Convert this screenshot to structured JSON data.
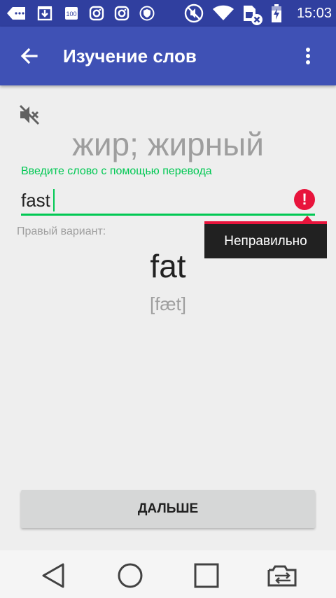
{
  "status_bar": {
    "time": "15:03",
    "icons": [
      "back-arrow-notification-icon",
      "download-notification-icon",
      "storage-100-icon",
      "instagram-icon",
      "instagram-icon",
      "shield-icon",
      "mute-icon",
      "wifi-icon",
      "no-sim-icon",
      "battery-charging-icon"
    ],
    "storage_text": "100"
  },
  "toolbar": {
    "title": "Изучение слов",
    "back_icon": "arrow-back-icon",
    "menu_icon": "more-vert-icon"
  },
  "lesson": {
    "sound_icon": "volume-off-icon",
    "word": "жир; жирный",
    "hint": "Введите слово с помощью перевода",
    "input_value": "fast",
    "error_icon": "!",
    "error_message": "Неправильно",
    "correct_label": "Правый вариант:",
    "answer": "fat",
    "transcription": "[fæt]",
    "next_label": "ДАЛЬШЕ"
  },
  "nav": {
    "icons": [
      "back-triangle-icon",
      "home-circle-icon",
      "recents-square-icon",
      "switch-sim-icon"
    ]
  },
  "colors": {
    "status_bar": "#303f9f",
    "toolbar": "#3f51b5",
    "accent_green": "#00c853",
    "error_red": "#e8143c"
  }
}
